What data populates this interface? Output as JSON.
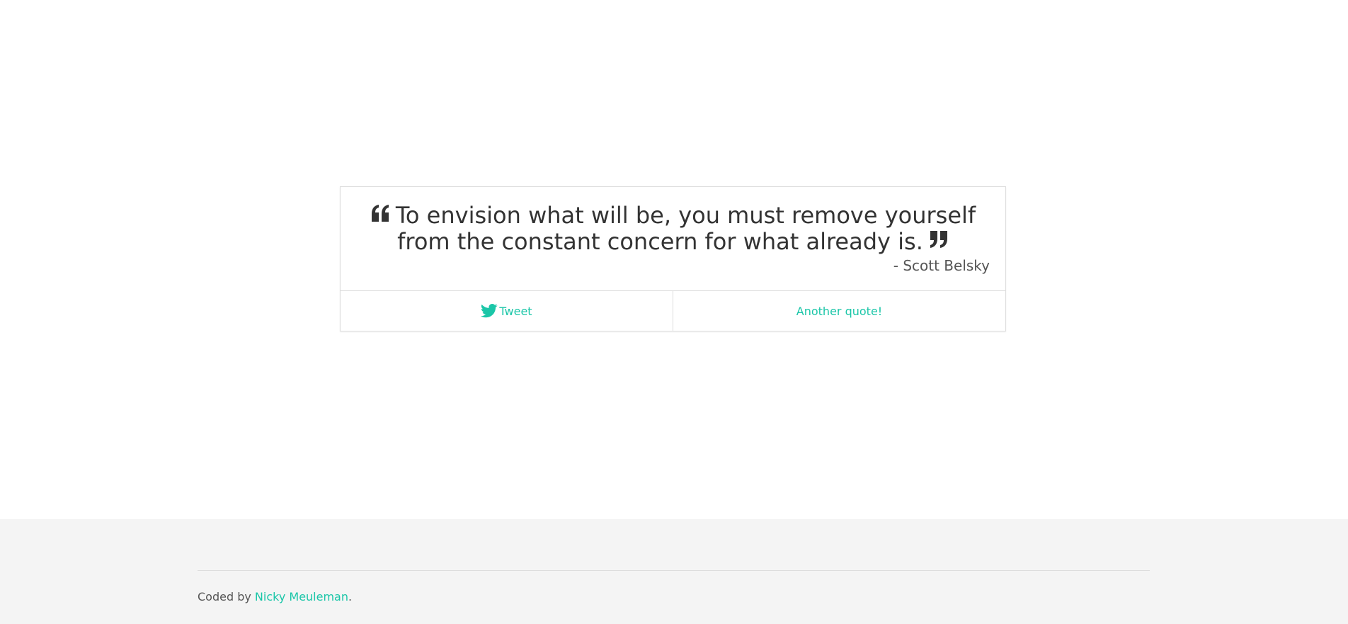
{
  "quote": {
    "text": "To envision what will be, you must remove yourself from the constant concern for what already is.",
    "author": "- Scott Belsky",
    "open_icon": "quote-left-icon",
    "close_icon": "quote-right-icon"
  },
  "actions": {
    "tweet_label": "Tweet",
    "tweet_icon": "twitter-icon",
    "another_label": "Another quote!"
  },
  "footer": {
    "credit_prefix": "Coded by ",
    "author_link": "Nicky Meuleman",
    "credit_suffix": "."
  },
  "colors": {
    "accent": "#1bc6a8",
    "text": "#333333",
    "footer_bg": "#f4f4f4"
  }
}
